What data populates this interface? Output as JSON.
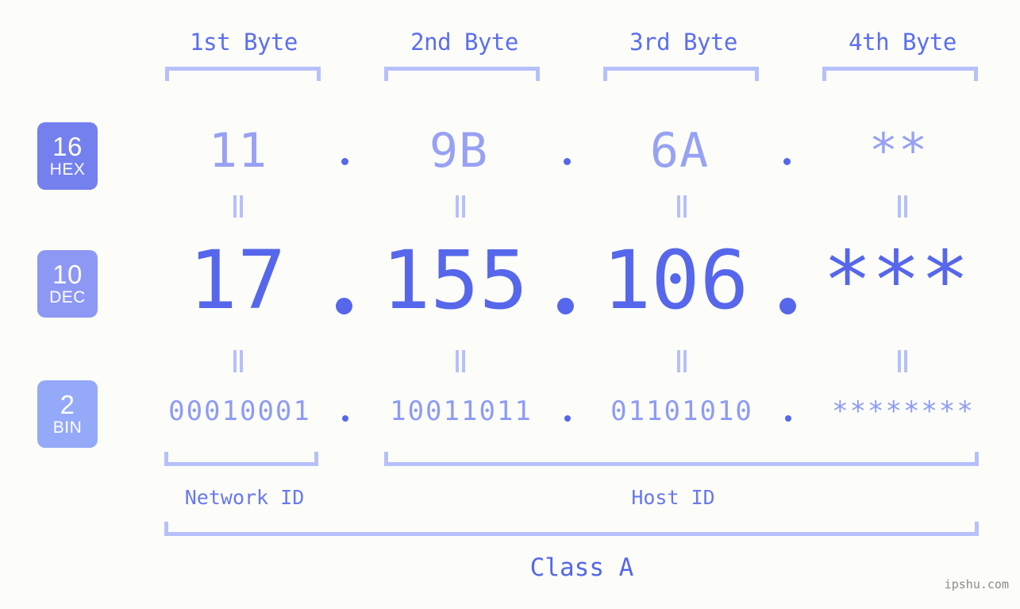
{
  "meta": {
    "watermark": "ipshu.com",
    "class_label": "Class A",
    "accent_strong": "#5667ec",
    "accent_mid": "#8e9bf5",
    "accent_light": "#b6c0fb",
    "background": "#fcfdf9"
  },
  "byte_headers": [
    {
      "label": "1st Byte"
    },
    {
      "label": "2nd Byte"
    },
    {
      "label": "3rd Byte"
    },
    {
      "label": "4th Byte"
    }
  ],
  "bases": [
    {
      "key": "hex",
      "number": "16",
      "name": "HEX",
      "color": "#7480ee"
    },
    {
      "key": "dec",
      "number": "10",
      "name": "DEC",
      "color": "#8d97f4"
    },
    {
      "key": "bin",
      "number": "2",
      "name": "BIN",
      "color": "#95a9f9"
    }
  ],
  "rows": {
    "hex": {
      "base_label": "HEX",
      "values": [
        "11",
        "9B",
        "6A",
        "**"
      ],
      "separators": [
        ".",
        ".",
        "."
      ]
    },
    "dec": {
      "base_label": "DEC",
      "values": [
        "17",
        "155",
        "106",
        "***"
      ],
      "separators": [
        ".",
        ".",
        "."
      ]
    },
    "bin": {
      "base_label": "BIN",
      "values": [
        "00010001",
        "10011011",
        "01101010",
        "********"
      ],
      "separators": [
        ".",
        ".",
        "."
      ]
    }
  },
  "equals_marks": {
    "symbol": "=",
    "rows": [
      "hex-to-dec",
      "dec-to-bin"
    ]
  },
  "id_sections": [
    {
      "label": "Network ID"
    },
    {
      "label": "Host ID"
    }
  ]
}
